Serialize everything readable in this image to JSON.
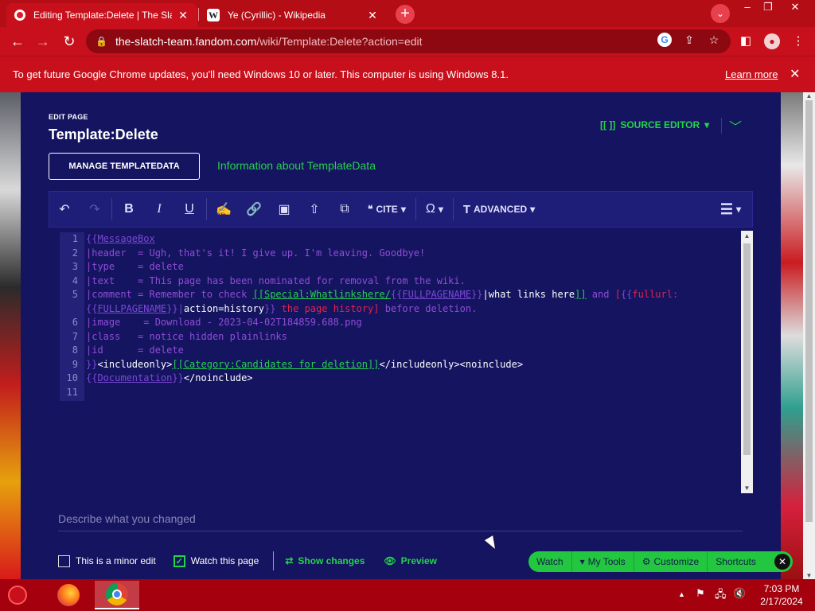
{
  "browser": {
    "tabs": [
      {
        "title": "Editing Template:Delete | The Slatch",
        "active": true
      },
      {
        "title": "Ye (Cyrillic) - Wikipedia",
        "active": false
      }
    ],
    "new_tab_symbol": "+",
    "url_host": "the-slatch-team.fandom.com",
    "url_path": "/wiki/Template:Delete?action=edit",
    "infobar_message": "To get future Google Chrome updates, you'll need Windows 10 or later. This computer is using Windows 8.1.",
    "infobar_link": "Learn more"
  },
  "editor": {
    "kicker": "EDIT PAGE",
    "page_title": "Template:Delete",
    "source_editor_label": "SOURCE EDITOR",
    "manage_button": "MANAGE TEMPLATEDATA",
    "info_link": "Information about TemplateData",
    "toolbar": {
      "cite_label": "CITE",
      "advanced_label": "ADVANCED"
    },
    "code_lines": [
      {
        "n": "1",
        "parts": [
          [
            "{{",
            "c-purple"
          ],
          [
            "MessageBox",
            "c-tmpl"
          ]
        ]
      },
      {
        "n": "2",
        "parts": [
          [
            "|header  = Ugh, that's it! I give up. I'm leaving. Goodbye!",
            ""
          ]
        ]
      },
      {
        "n": "3",
        "parts": [
          [
            "|type    = delete",
            ""
          ]
        ]
      },
      {
        "n": "4",
        "parts": [
          [
            "|text    = This page has been nominated for removal from the wiki.",
            ""
          ]
        ]
      },
      {
        "n": "5",
        "parts": [
          [
            "|comment = Remember to check ",
            ""
          ],
          [
            "[[",
            "c-green"
          ],
          [
            "Special:Whatlinkshere/",
            "c-green"
          ],
          [
            "{{",
            "c-purple"
          ],
          [
            "FULLPAGENAME",
            "c-tmpl"
          ],
          [
            "}}",
            "c-purple"
          ],
          [
            "|what links here",
            "c-white"
          ],
          [
            "]]",
            "c-green"
          ],
          [
            " and ",
            ""
          ],
          [
            "[",
            "c-red"
          ],
          [
            "{{",
            "c-purple"
          ],
          [
            "fullurl:",
            "c-red"
          ]
        ]
      },
      {
        "n": "",
        "parts": [
          [
            "{{",
            "c-purple"
          ],
          [
            "FULLPAGENAME",
            "c-tmpl"
          ],
          [
            "}}",
            "c-purple"
          ],
          [
            "|",
            "c-pipe"
          ],
          [
            "action=history",
            "c-white"
          ],
          [
            "}}",
            "c-purple"
          ],
          [
            " the page history]",
            "c-red"
          ],
          [
            " before deletion.",
            ""
          ]
        ]
      },
      {
        "n": "6",
        "parts": [
          [
            "|image    = Download - 2023-04-02T184859.688.png",
            ""
          ]
        ]
      },
      {
        "n": "7",
        "parts": [
          [
            "|class   = notice hidden plainlinks",
            ""
          ]
        ]
      },
      {
        "n": "8",
        "parts": [
          [
            "|id      = delete",
            ""
          ]
        ]
      },
      {
        "n": "9",
        "parts": [
          [
            "}}",
            "c-purple"
          ],
          [
            "<includeonly>",
            "c-white"
          ],
          [
            "[[",
            "c-green"
          ],
          [
            "Category:Candidates for deletion",
            "c-green"
          ],
          [
            "]]",
            "c-green"
          ],
          [
            "</includeonly><noinclude>",
            "c-white"
          ]
        ]
      },
      {
        "n": "10",
        "parts": [
          [
            "{{",
            "c-purple"
          ],
          [
            "Documentation",
            "c-tmpl"
          ],
          [
            "}}",
            "c-purple"
          ],
          [
            "</noinclude>",
            "c-white"
          ]
        ]
      },
      {
        "n": "11",
        "parts": []
      }
    ],
    "summary_placeholder": "Describe what you changed",
    "minor_edit_label": "This is a minor edit",
    "watch_page_label": "Watch this page",
    "show_changes_label": "Show changes",
    "preview_label": "Preview"
  },
  "fandom_toolbar": {
    "watch": "Watch",
    "my_tools": "My Tools",
    "customize": "Customize",
    "shortcuts": "Shortcuts"
  },
  "taskbar": {
    "time": "7:03 PM",
    "date": "2/17/2024"
  },
  "colors": {
    "panel_bg": "#151460",
    "accent_green": "#24d34b",
    "chrome_red": "#c8101c"
  }
}
